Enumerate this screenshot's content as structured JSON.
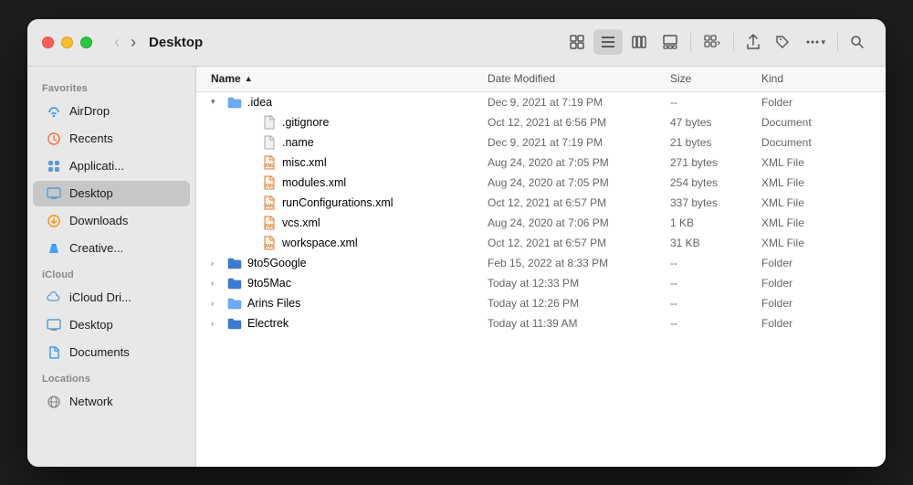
{
  "window": {
    "title": "Desktop"
  },
  "traffic_lights": {
    "red": "close",
    "yellow": "minimize",
    "green": "maximize"
  },
  "toolbar": {
    "back_label": "‹",
    "forward_label": "›",
    "view_icons": [
      {
        "name": "icon-view-btn",
        "icon": "⊞",
        "label": "Icon View"
      },
      {
        "name": "list-view-btn",
        "icon": "≡",
        "label": "List View",
        "active": true
      },
      {
        "name": "column-view-btn",
        "icon": "⊟",
        "label": "Column View"
      },
      {
        "name": "gallery-view-btn",
        "icon": "▤",
        "label": "Gallery View"
      }
    ],
    "group_btn": "⊞▾",
    "share_btn": "↑",
    "tag_btn": "◇",
    "more_btn": "···▾",
    "search_btn": "⌕"
  },
  "sidebar": {
    "sections": [
      {
        "label": "Favorites",
        "items": [
          {
            "name": "AirDrop",
            "icon": "airdrop",
            "active": false
          },
          {
            "name": "Recents",
            "icon": "recents",
            "active": false
          },
          {
            "name": "Applicati...",
            "icon": "apps",
            "active": false
          },
          {
            "name": "Desktop",
            "icon": "desktop",
            "active": true
          },
          {
            "name": "Downloads",
            "icon": "downloads",
            "active": false
          },
          {
            "name": "Creative...",
            "icon": "creative",
            "active": false
          }
        ]
      },
      {
        "label": "iCloud",
        "items": [
          {
            "name": "iCloud Dri...",
            "icon": "icloud",
            "active": false
          },
          {
            "name": "Desktop",
            "icon": "desktop",
            "active": false
          },
          {
            "name": "Documents",
            "icon": "documents",
            "active": false
          }
        ]
      },
      {
        "label": "Locations",
        "items": [
          {
            "name": "Network",
            "icon": "network",
            "active": false
          }
        ]
      }
    ]
  },
  "file_list": {
    "columns": [
      {
        "label": "Name",
        "key": "name",
        "active": true,
        "sort": "asc"
      },
      {
        "label": "Date Modified",
        "key": "date"
      },
      {
        "label": "Size",
        "key": "size"
      },
      {
        "label": "Kind",
        "key": "kind"
      }
    ],
    "rows": [
      {
        "id": 1,
        "indent": 0,
        "expanded": true,
        "expand_arrow": "▾",
        "icon": "folder",
        "icon_color": "blue",
        "name": ".idea",
        "date": "Dec 9, 2021 at 7:19 PM",
        "size": "--",
        "kind": "Folder"
      },
      {
        "id": 2,
        "indent": 1,
        "expanded": false,
        "expand_arrow": "",
        "icon": "doc",
        "icon_color": "gray",
        "name": ".gitignore",
        "date": "Oct 12, 2021 at 6:56 PM",
        "size": "47 bytes",
        "kind": "Document"
      },
      {
        "id": 3,
        "indent": 1,
        "expanded": false,
        "expand_arrow": "",
        "icon": "doc",
        "icon_color": "gray",
        "name": ".name",
        "date": "Dec 9, 2021 at 7:19 PM",
        "size": "21 bytes",
        "kind": "Document"
      },
      {
        "id": 4,
        "indent": 1,
        "expanded": false,
        "expand_arrow": "",
        "icon": "xml",
        "icon_color": "orange",
        "name": "misc.xml",
        "date": "Aug 24, 2020 at 7:05 PM",
        "size": "271 bytes",
        "kind": "XML File"
      },
      {
        "id": 5,
        "indent": 1,
        "expanded": false,
        "expand_arrow": "",
        "icon": "xml",
        "icon_color": "orange",
        "name": "modules.xml",
        "date": "Aug 24, 2020 at 7:05 PM",
        "size": "254 bytes",
        "kind": "XML File"
      },
      {
        "id": 6,
        "indent": 1,
        "expanded": false,
        "expand_arrow": "",
        "icon": "xml",
        "icon_color": "orange",
        "name": "runConfigurations.xml",
        "date": "Oct 12, 2021 at 6:57 PM",
        "size": "337 bytes",
        "kind": "XML File"
      },
      {
        "id": 7,
        "indent": 1,
        "expanded": false,
        "expand_arrow": "",
        "icon": "xml",
        "icon_color": "orange",
        "name": "vcs.xml",
        "date": "Aug 24, 2020 at 7:06 PM",
        "size": "1 KB",
        "kind": "XML File"
      },
      {
        "id": 8,
        "indent": 1,
        "expanded": false,
        "expand_arrow": "",
        "icon": "xml",
        "icon_color": "orange",
        "name": "workspace.xml",
        "date": "Oct 12, 2021 at 6:57 PM",
        "size": "31 KB",
        "kind": "XML File"
      },
      {
        "id": 9,
        "indent": 0,
        "expanded": false,
        "expand_arrow": "›",
        "icon": "folder",
        "icon_color": "dark-blue",
        "name": "9to5Google",
        "date": "Feb 15, 2022 at 8:33 PM",
        "size": "--",
        "kind": "Folder"
      },
      {
        "id": 10,
        "indent": 0,
        "expanded": false,
        "expand_arrow": "›",
        "icon": "folder",
        "icon_color": "dark-blue",
        "name": "9to5Mac",
        "date": "Today at 12:33 PM",
        "size": "--",
        "kind": "Folder"
      },
      {
        "id": 11,
        "indent": 0,
        "expanded": false,
        "expand_arrow": "›",
        "icon": "folder",
        "icon_color": "blue",
        "name": "Arins Files",
        "date": "Today at 12:26 PM",
        "size": "--",
        "kind": "Folder"
      },
      {
        "id": 12,
        "indent": 0,
        "expanded": false,
        "expand_arrow": "›",
        "icon": "folder",
        "icon_color": "dark-blue",
        "name": "Electrek",
        "date": "Today at 11:39 AM",
        "size": "--",
        "kind": "Folder"
      }
    ]
  }
}
